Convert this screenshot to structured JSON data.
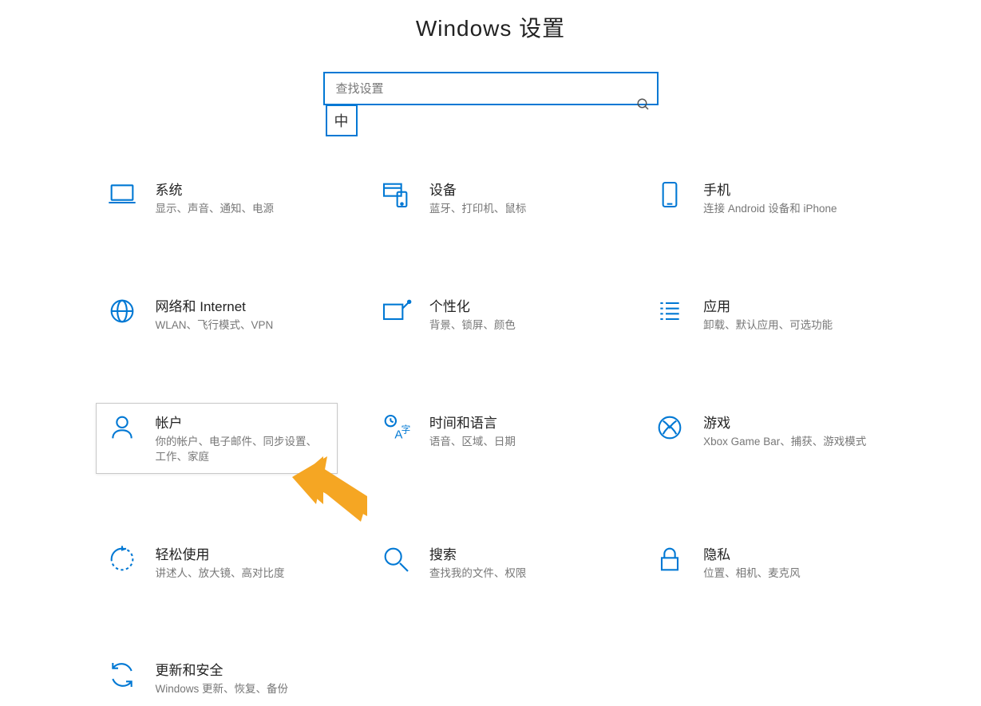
{
  "title": "Windows 设置",
  "search": {
    "placeholder": "查找设置"
  },
  "ime_badge": "中",
  "accent": "#0078d4",
  "tiles": [
    {
      "id": "system",
      "title": "系统",
      "desc": "显示、声音、通知、电源"
    },
    {
      "id": "devices",
      "title": "设备",
      "desc": "蓝牙、打印机、鼠标"
    },
    {
      "id": "phone",
      "title": "手机",
      "desc": "连接 Android 设备和 iPhone"
    },
    {
      "id": "network",
      "title": "网络和 Internet",
      "desc": "WLAN、飞行模式、VPN"
    },
    {
      "id": "personalization",
      "title": "个性化",
      "desc": "背景、锁屏、颜色"
    },
    {
      "id": "apps",
      "title": "应用",
      "desc": "卸载、默认应用、可选功能"
    },
    {
      "id": "accounts",
      "title": "帐户",
      "desc": "你的帐户、电子邮件、同步设置、工作、家庭",
      "highlight": true
    },
    {
      "id": "time-language",
      "title": "时间和语言",
      "desc": "语音、区域、日期"
    },
    {
      "id": "gaming",
      "title": "游戏",
      "desc": "Xbox Game Bar、捕获、游戏模式"
    },
    {
      "id": "ease-of-access",
      "title": "轻松使用",
      "desc": "讲述人、放大镜、高对比度"
    },
    {
      "id": "search",
      "title": "搜索",
      "desc": "查找我的文件、权限"
    },
    {
      "id": "privacy",
      "title": "隐私",
      "desc": "位置、相机、麦克风"
    },
    {
      "id": "update",
      "title": "更新和安全",
      "desc": "Windows 更新、恢复、备份"
    }
  ]
}
